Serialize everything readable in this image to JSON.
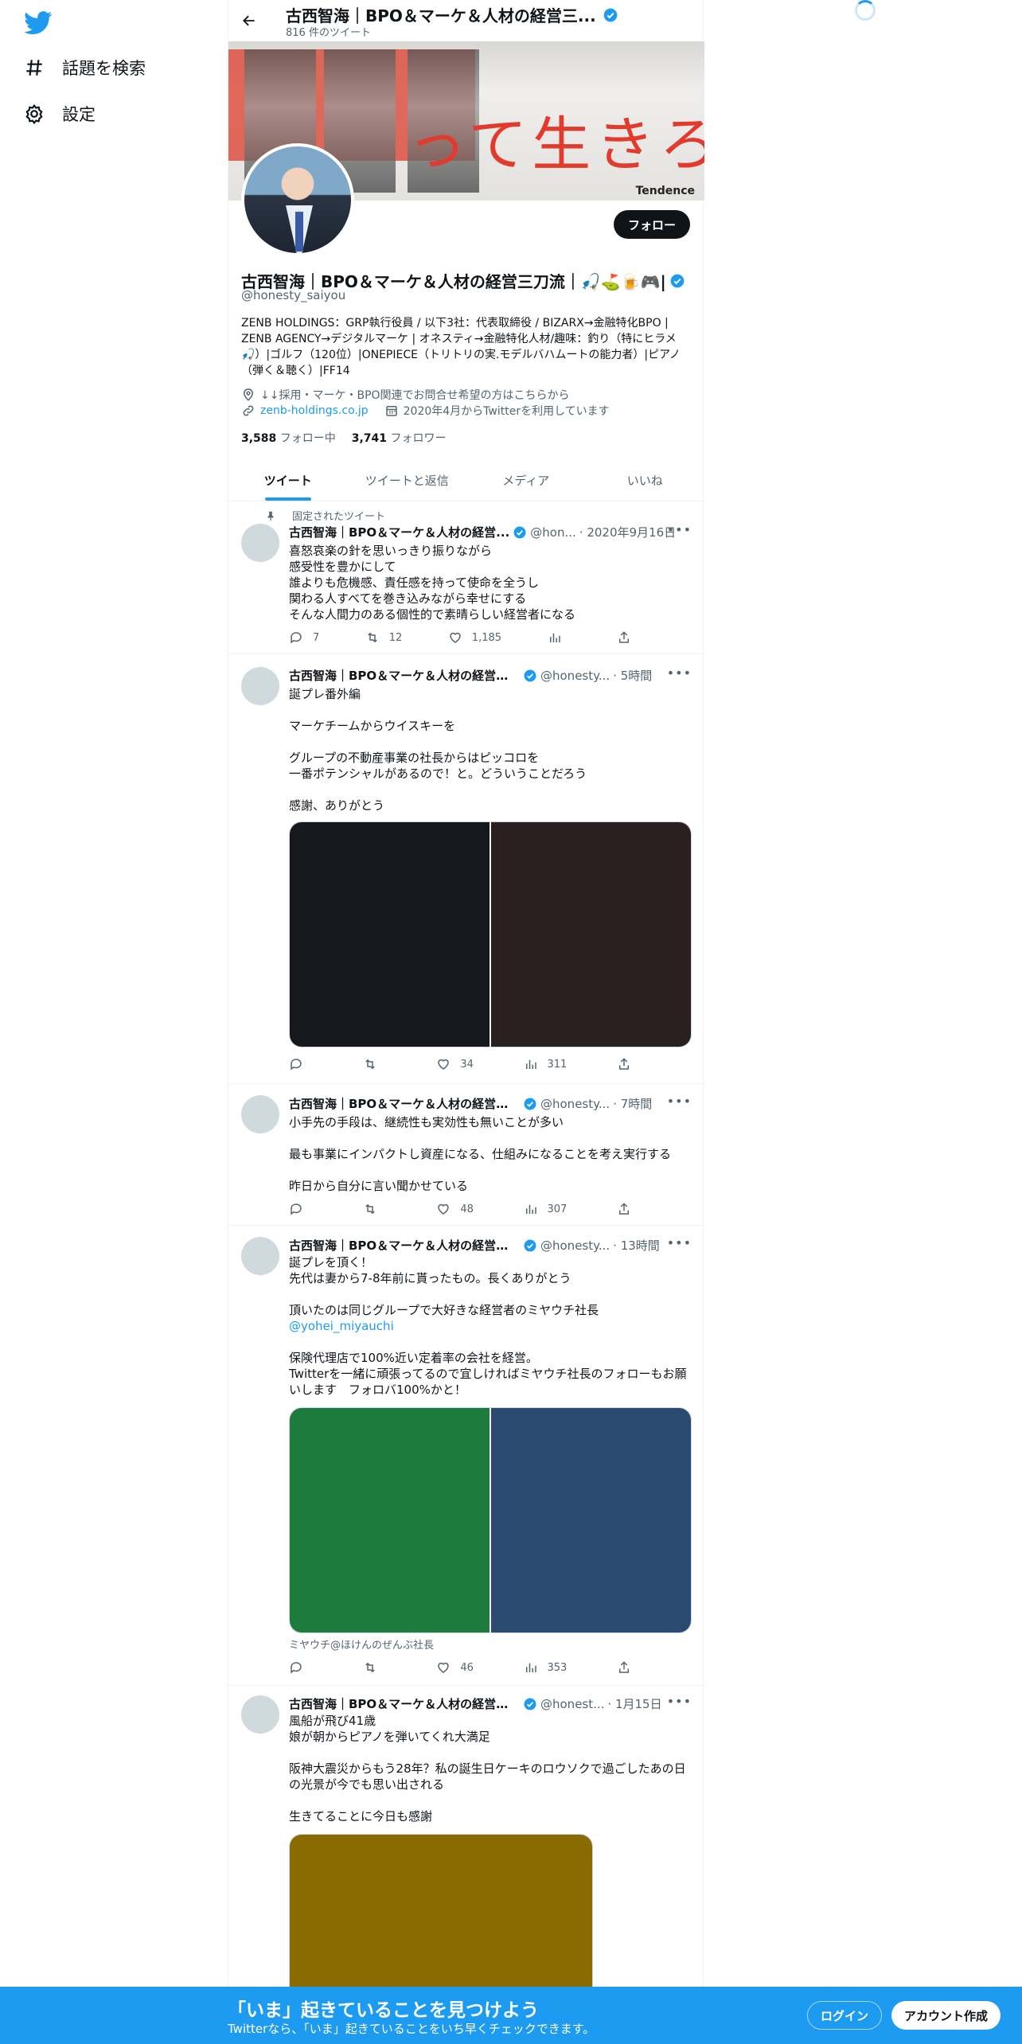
{
  "nav": {
    "items": [
      {
        "label": "話題を検索",
        "icon": "hashtag-icon"
      },
      {
        "label": "設定",
        "icon": "gear-icon"
      }
    ]
  },
  "header": {
    "title": "古西智海｜BPO＆マーケ＆人材の経営三...",
    "tweet_count": "816 件のツイート"
  },
  "banner": {
    "text": "って生きろや。",
    "brand": "Tendence"
  },
  "profile": {
    "follow_label": "フォロー",
    "name": "古西智海｜BPO＆マーケ＆人材の経営三刀流｜🎣⛳🍺🎮|",
    "handle": "@honesty_saiyou",
    "bio": "ZENB HOLDINGS：GRP執行役員 / 以下3社：代表取締役 /  BIZARX→金融特化BPO | ZENB AGENCY→デジタルマーケ | オネスティ→金融特化人材/趣味：釣り（特にヒラメ🎣）|ゴルフ（120位）|ONEPIECE（トリトリの実.モデルバハムートの能力者）|ピアノ（弾く＆聴く）|FF14",
    "location": "↓↓採用・マーケ・BPO関連でお問合せ希望の方はこちらから",
    "website": "zenb-holdings.co.jp",
    "joined": "2020年4月からTwitterを利用しています",
    "following_count": "3,588",
    "following_label": "フォロー中",
    "followers_count": "3,741",
    "followers_label": "フォロワー"
  },
  "tabs": [
    "ツイート",
    "ツイートと返信",
    "メディア",
    "いいね"
  ],
  "tweets": [
    {
      "pinned_label": "固定されたツイート",
      "name": "古西智海｜BPO＆マーケ＆人材の経営...",
      "handle": "@hon...",
      "time": "· 2020年9月16日",
      "text": "喜怒哀楽の針を思いっきり振りながら\n感受性を豊かにして\n誰よりも危機感、責任感を持って使命を全うし\n関わる人すべてを巻き込みながら幸せにする\nそんな人間力のある個性的で素晴らしい経営者になる",
      "replies": "7",
      "retweets": "12",
      "likes": "1,185",
      "views": ""
    },
    {
      "name": "古西智海｜BPO＆マーケ＆人材の経営三刀...",
      "handle": "@honesty...",
      "time": "· 5時間",
      "text": "誕プレ番外編\n\nマーケチームからウイスキーを\n\nグループの不動産事業の社長からはピッコロを\n一番ポテンシャルがあるので！と。どういうことだろう\n\n感謝、ありがとう",
      "media_colors": [
        "#15181d",
        "#2a2020"
      ],
      "replies": "",
      "retweets": "",
      "likes": "34",
      "views": "311"
    },
    {
      "name": "古西智海｜BPO＆マーケ＆人材の経営三刀...",
      "handle": "@honesty...",
      "time": "· 7時間",
      "text": "小手先の手段は、継続性も実効性も無いことが多い\n\n最も事業にインパクトし資産になる、仕組みになることを考え実行する\n\n昨日から自分に言い聞かせている",
      "replies": "",
      "retweets": "",
      "likes": "48",
      "views": "307"
    },
    {
      "name": "古西智海｜BPO＆マーケ＆人材の経営三刀...",
      "handle": "@honesty...",
      "time": "· 13時間",
      "text_lines": [
        "誕プレを頂く！",
        "先代は妻から7-8年前に貰ったもの。長くありがとう",
        "",
        "頂いたのは同じグループで大好きな経営者のミヤウチ社長"
      ],
      "mention": "@yohei_miyauchi",
      "text_after": "保険代理店で100%近い定着率の会社を経営。\nTwitterを一緒に頑張ってるので宜しければミヤウチ社長のフォローもお願いします　フォロバ100%かと！",
      "media_colors": [
        "#1d7b3d",
        "#2a4a72"
      ],
      "caption": "ミヤウチ@ほけんのぜんぶ社長",
      "replies": "",
      "retweets": "",
      "likes": "46",
      "views": "353"
    },
    {
      "name": "古西智海｜BPO＆マーケ＆人材の経営三刀...",
      "handle": "@honest...",
      "time": "· 1月15日",
      "text": "風船が飛び41歳\n娘が朝からピアノを弾いてくれ大満足\n\n阪神大震災からもう28年？私の誕生日ケーキのロウソクで過ごしたあの日の光景が今でも思い出される\n\n生きてることに今日も感謝",
      "media_colors": [
        "#8a6b00"
      ]
    }
  ],
  "bottom_bar": {
    "title": "「いま」起きていることを見つけよう",
    "subtitle": "Twitterなら、「いま」起きていることをいち早くチェックできます。",
    "login": "ログイン",
    "signup": "アカウント作成"
  },
  "colors": {
    "accent": "#1d9bf0",
    "text": "#0f1419",
    "muted": "#536471"
  }
}
